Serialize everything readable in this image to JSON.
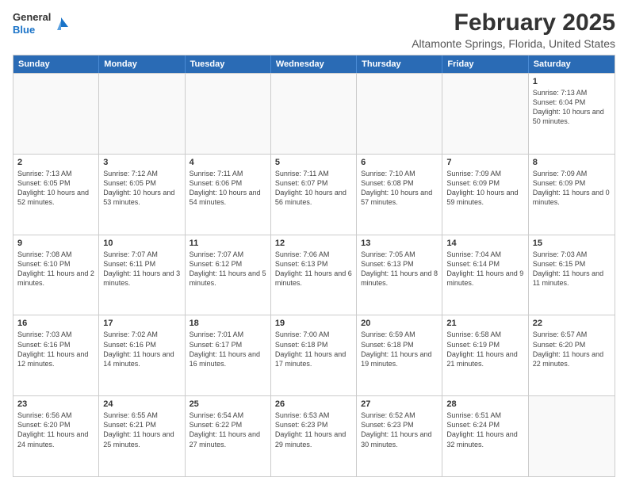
{
  "logo": {
    "line1": "General",
    "line2": "Blue"
  },
  "header": {
    "month": "February 2025",
    "location": "Altamonte Springs, Florida, United States"
  },
  "days": [
    "Sunday",
    "Monday",
    "Tuesday",
    "Wednesday",
    "Thursday",
    "Friday",
    "Saturday"
  ],
  "weeks": [
    [
      {
        "day": "",
        "text": ""
      },
      {
        "day": "",
        "text": ""
      },
      {
        "day": "",
        "text": ""
      },
      {
        "day": "",
        "text": ""
      },
      {
        "day": "",
        "text": ""
      },
      {
        "day": "",
        "text": ""
      },
      {
        "day": "1",
        "text": "Sunrise: 7:13 AM\nSunset: 6:04 PM\nDaylight: 10 hours and 50 minutes."
      }
    ],
    [
      {
        "day": "2",
        "text": "Sunrise: 7:13 AM\nSunset: 6:05 PM\nDaylight: 10 hours and 52 minutes."
      },
      {
        "day": "3",
        "text": "Sunrise: 7:12 AM\nSunset: 6:05 PM\nDaylight: 10 hours and 53 minutes."
      },
      {
        "day": "4",
        "text": "Sunrise: 7:11 AM\nSunset: 6:06 PM\nDaylight: 10 hours and 54 minutes."
      },
      {
        "day": "5",
        "text": "Sunrise: 7:11 AM\nSunset: 6:07 PM\nDaylight: 10 hours and 56 minutes."
      },
      {
        "day": "6",
        "text": "Sunrise: 7:10 AM\nSunset: 6:08 PM\nDaylight: 10 hours and 57 minutes."
      },
      {
        "day": "7",
        "text": "Sunrise: 7:09 AM\nSunset: 6:09 PM\nDaylight: 10 hours and 59 minutes."
      },
      {
        "day": "8",
        "text": "Sunrise: 7:09 AM\nSunset: 6:09 PM\nDaylight: 11 hours and 0 minutes."
      }
    ],
    [
      {
        "day": "9",
        "text": "Sunrise: 7:08 AM\nSunset: 6:10 PM\nDaylight: 11 hours and 2 minutes."
      },
      {
        "day": "10",
        "text": "Sunrise: 7:07 AM\nSunset: 6:11 PM\nDaylight: 11 hours and 3 minutes."
      },
      {
        "day": "11",
        "text": "Sunrise: 7:07 AM\nSunset: 6:12 PM\nDaylight: 11 hours and 5 minutes."
      },
      {
        "day": "12",
        "text": "Sunrise: 7:06 AM\nSunset: 6:13 PM\nDaylight: 11 hours and 6 minutes."
      },
      {
        "day": "13",
        "text": "Sunrise: 7:05 AM\nSunset: 6:13 PM\nDaylight: 11 hours and 8 minutes."
      },
      {
        "day": "14",
        "text": "Sunrise: 7:04 AM\nSunset: 6:14 PM\nDaylight: 11 hours and 9 minutes."
      },
      {
        "day": "15",
        "text": "Sunrise: 7:03 AM\nSunset: 6:15 PM\nDaylight: 11 hours and 11 minutes."
      }
    ],
    [
      {
        "day": "16",
        "text": "Sunrise: 7:03 AM\nSunset: 6:16 PM\nDaylight: 11 hours and 12 minutes."
      },
      {
        "day": "17",
        "text": "Sunrise: 7:02 AM\nSunset: 6:16 PM\nDaylight: 11 hours and 14 minutes."
      },
      {
        "day": "18",
        "text": "Sunrise: 7:01 AM\nSunset: 6:17 PM\nDaylight: 11 hours and 16 minutes."
      },
      {
        "day": "19",
        "text": "Sunrise: 7:00 AM\nSunset: 6:18 PM\nDaylight: 11 hours and 17 minutes."
      },
      {
        "day": "20",
        "text": "Sunrise: 6:59 AM\nSunset: 6:18 PM\nDaylight: 11 hours and 19 minutes."
      },
      {
        "day": "21",
        "text": "Sunrise: 6:58 AM\nSunset: 6:19 PM\nDaylight: 11 hours and 21 minutes."
      },
      {
        "day": "22",
        "text": "Sunrise: 6:57 AM\nSunset: 6:20 PM\nDaylight: 11 hours and 22 minutes."
      }
    ],
    [
      {
        "day": "23",
        "text": "Sunrise: 6:56 AM\nSunset: 6:20 PM\nDaylight: 11 hours and 24 minutes."
      },
      {
        "day": "24",
        "text": "Sunrise: 6:55 AM\nSunset: 6:21 PM\nDaylight: 11 hours and 25 minutes."
      },
      {
        "day": "25",
        "text": "Sunrise: 6:54 AM\nSunset: 6:22 PM\nDaylight: 11 hours and 27 minutes."
      },
      {
        "day": "26",
        "text": "Sunrise: 6:53 AM\nSunset: 6:23 PM\nDaylight: 11 hours and 29 minutes."
      },
      {
        "day": "27",
        "text": "Sunrise: 6:52 AM\nSunset: 6:23 PM\nDaylight: 11 hours and 30 minutes."
      },
      {
        "day": "28",
        "text": "Sunrise: 6:51 AM\nSunset: 6:24 PM\nDaylight: 11 hours and 32 minutes."
      },
      {
        "day": "",
        "text": ""
      }
    ]
  ]
}
